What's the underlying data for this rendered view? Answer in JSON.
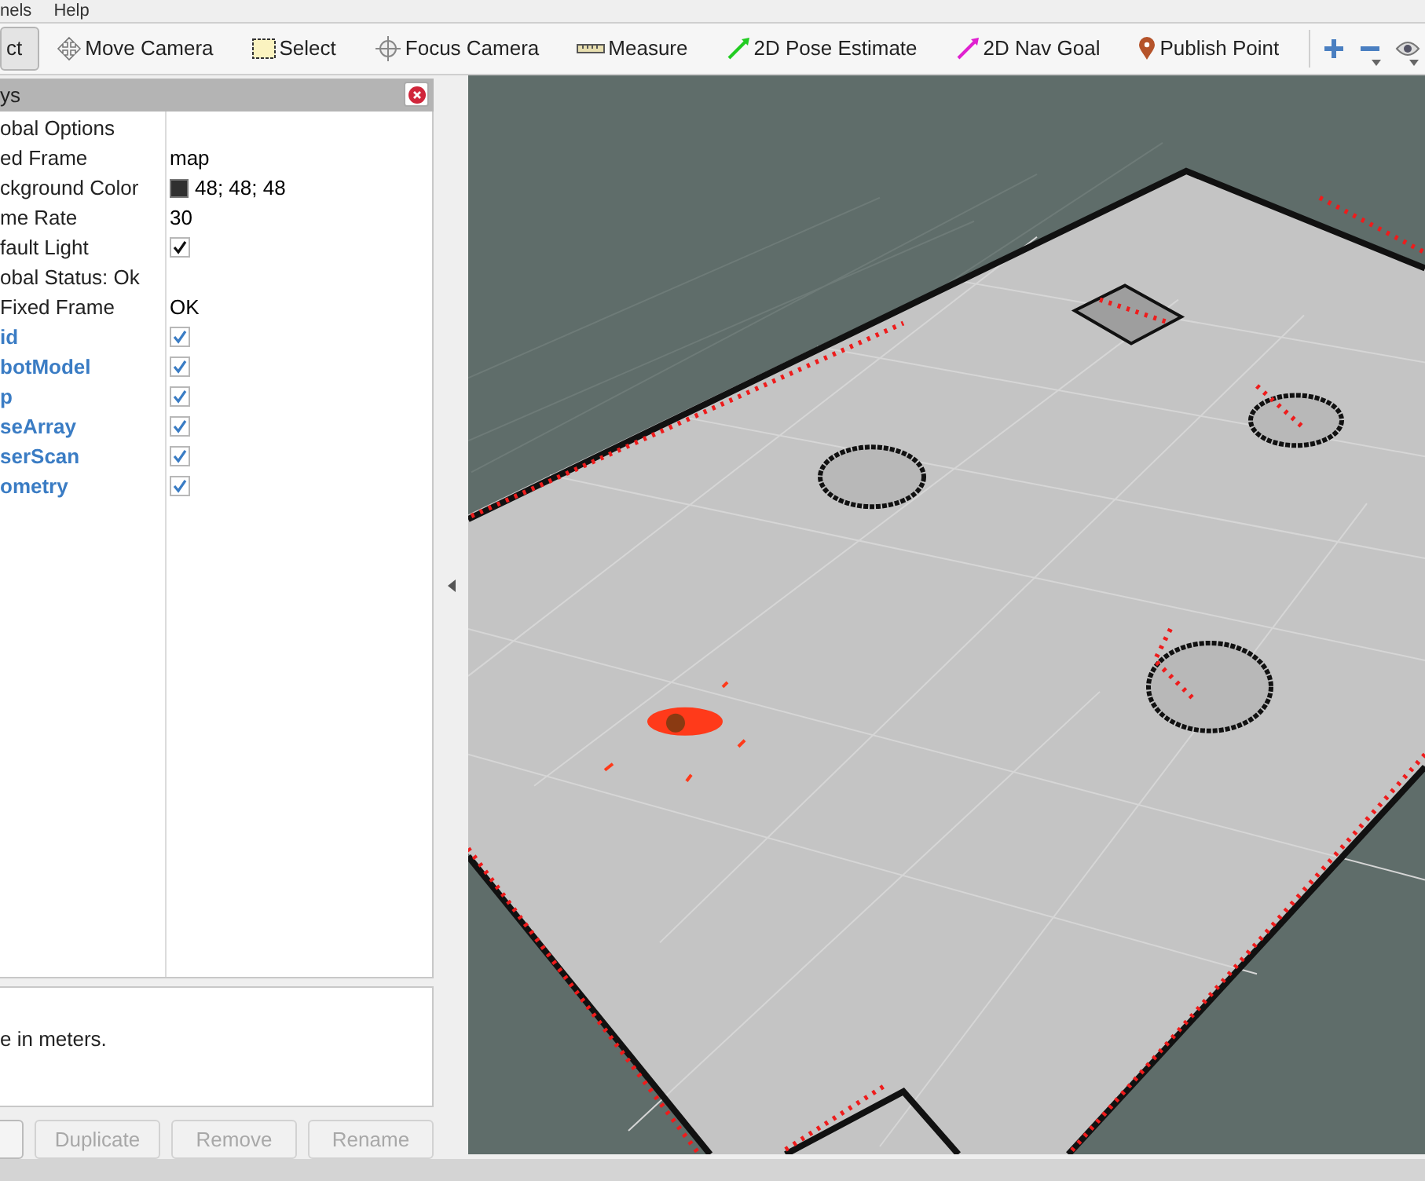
{
  "menu": [
    {
      "label": "nels"
    },
    {
      "label": "Help"
    }
  ],
  "toolbar": {
    "tools": [
      {
        "label": "ct",
        "kind": "interact",
        "selected": true
      },
      {
        "label": "Move Camera",
        "kind": "move",
        "selected": false
      },
      {
        "label": "Select",
        "kind": "select",
        "selected": false
      },
      {
        "label": "Focus Camera",
        "kind": "focus",
        "selected": false
      },
      {
        "label": "Measure",
        "kind": "measure",
        "selected": false
      },
      {
        "label": "2D Pose Estimate",
        "kind": "pose",
        "selected": false
      },
      {
        "label": "2D Nav Goal",
        "kind": "goal",
        "selected": false
      },
      {
        "label": "Publish Point",
        "kind": "point",
        "selected": false
      }
    ],
    "view_buttons": [
      {
        "kind": "add"
      },
      {
        "kind": "remove"
      },
      {
        "kind": "view"
      }
    ]
  },
  "displays_panel": {
    "title": "ys",
    "rows": [
      {
        "name": "obal Options",
        "kind": "group",
        "children": [
          {
            "name": "ed Frame",
            "kind": "property",
            "value": "map"
          },
          {
            "name": "ckground Color",
            "kind": "color",
            "value": "48; 48; 48",
            "color": "#303030"
          },
          {
            "name": "me Rate",
            "kind": "property",
            "value": "30"
          },
          {
            "name": "fault Light",
            "kind": "check",
            "checked": true
          }
        ]
      },
      {
        "name": "obal Status: Ok",
        "kind": "group",
        "children": [
          {
            "name": "Fixed Frame",
            "kind": "property",
            "value": "OK"
          }
        ]
      },
      {
        "name": "id",
        "kind": "display",
        "checked": true
      },
      {
        "name": "botModel",
        "kind": "display",
        "checked": true
      },
      {
        "name": "p",
        "kind": "display",
        "checked": true
      },
      {
        "name": "seArray",
        "kind": "display",
        "checked": true
      },
      {
        "name": "serScan",
        "kind": "display",
        "checked": true
      },
      {
        "name": "ometry",
        "kind": "display",
        "checked": true
      }
    ],
    "description": "e in meters.",
    "buttons": [
      {
        "disabled": false
      },
      {
        "label": "Duplicate",
        "disabled": true
      },
      {
        "label": "Remove",
        "disabled": true
      },
      {
        "label": "Rename",
        "disabled": true
      }
    ]
  }
}
